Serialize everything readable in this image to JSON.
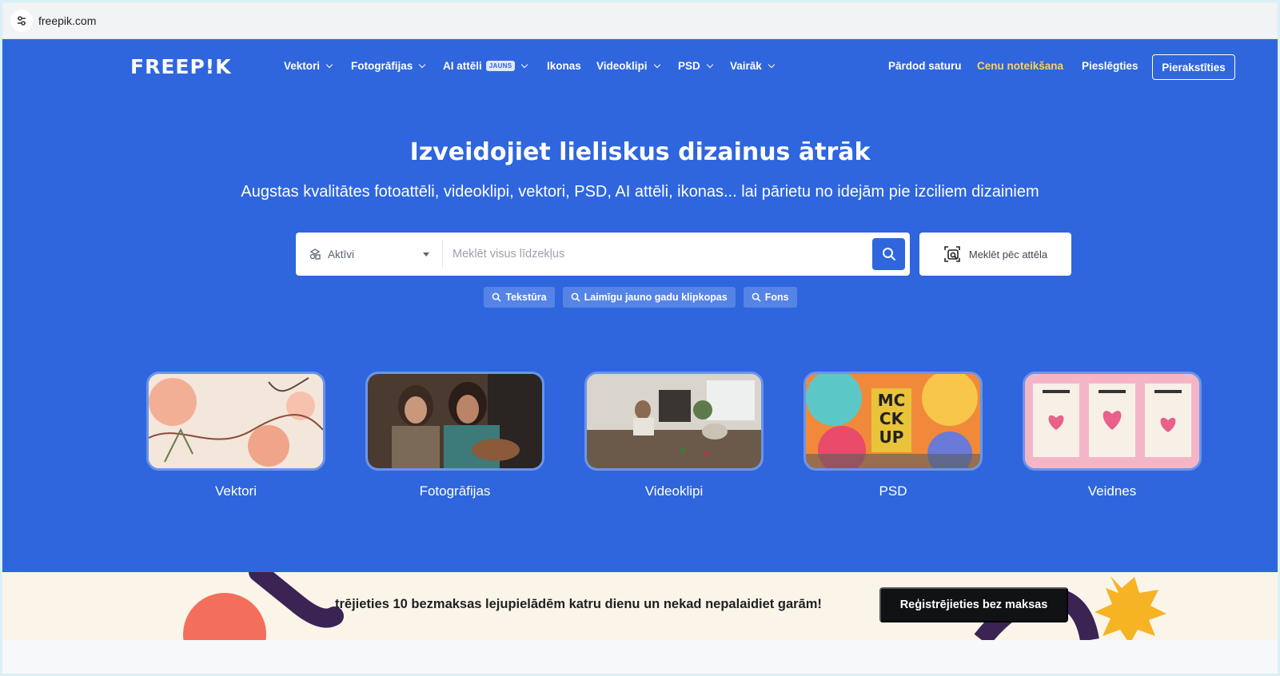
{
  "browser": {
    "url": "freepik.com"
  },
  "nav": {
    "logo": "FREEP!K",
    "items": [
      {
        "label": "Vektori",
        "dropdown": true
      },
      {
        "label": "Fotogrāfijas",
        "dropdown": true
      },
      {
        "label": "AI attēli",
        "badge": "JAUNS",
        "dropdown": true
      },
      {
        "label": "Ikonas",
        "dropdown": false
      },
      {
        "label": "Videoklipi",
        "dropdown": true
      },
      {
        "label": "PSD",
        "dropdown": true
      },
      {
        "label": "Vairāk",
        "dropdown": true
      }
    ],
    "sell": "Pārdod saturu",
    "pricing": "Cenu noteikšana",
    "login": "Pieslēgties",
    "signup": "Pierakstīties"
  },
  "hero": {
    "title": "Izveidojiet lieliskus dizainus ātrāk",
    "subtitle": "Augstas kvalitātes fotoattēli, videoklipi, vektori, PSD, AI attēli, ikonas... lai pārietu no idejām pie izciliem dizainiem"
  },
  "search": {
    "type_label": "Aktīvi",
    "placeholder": "Meklēt visus līdzekļus",
    "image_search_label": "Meklēt pēc attēla"
  },
  "chips": [
    "Tekstūra",
    "Laimīgu jauno gadu klipkopas",
    "Fons"
  ],
  "categories": [
    {
      "label": "Vektori"
    },
    {
      "label": "Fotogrāfijas"
    },
    {
      "label": "Videoklipi"
    },
    {
      "label": "PSD"
    },
    {
      "label": "Veidnes"
    }
  ],
  "promo": {
    "text": "trējieties 10 bezmaksas lejupielādēm katru dienu un nekad nepalaidiet garām!",
    "button": "Reģistrējieties bez maksas"
  },
  "colors": {
    "brand": "#2f66de",
    "accent": "#ffd15a",
    "promo_bg": "#fbf5e9"
  }
}
